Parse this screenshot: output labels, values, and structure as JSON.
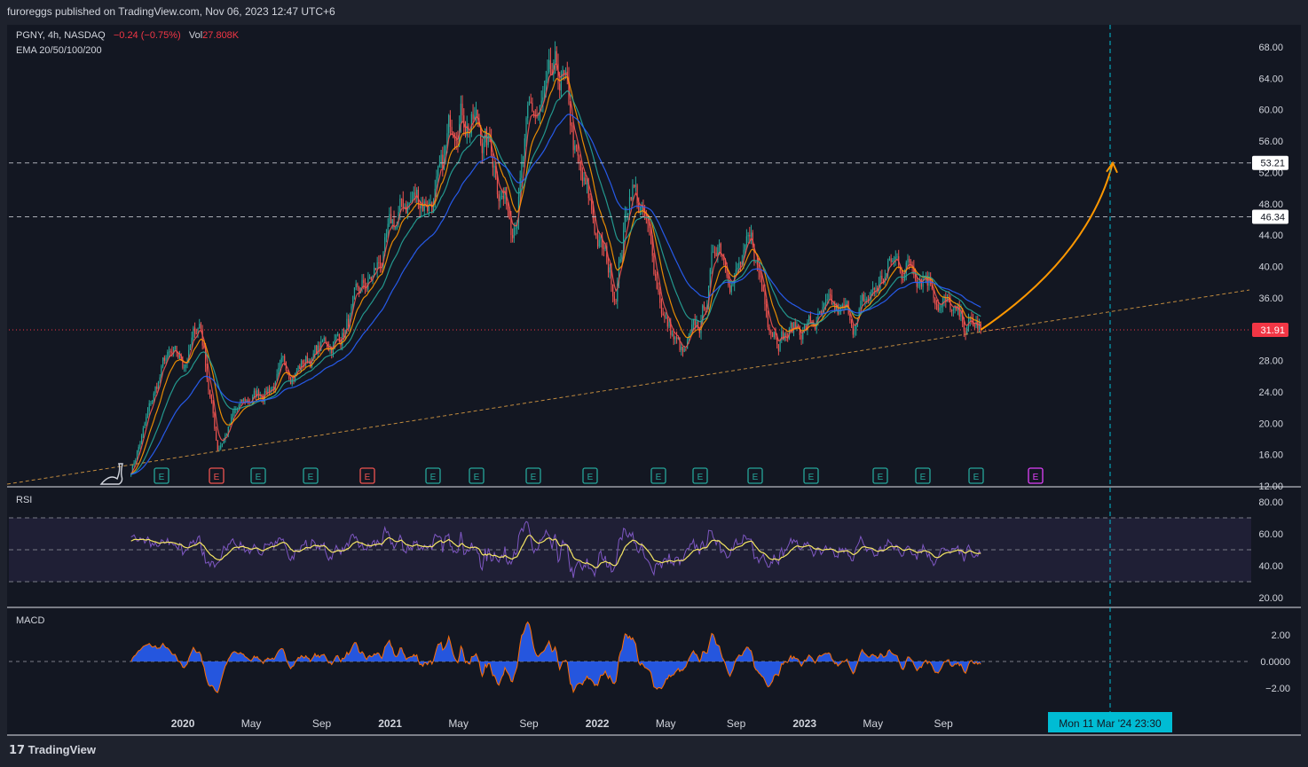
{
  "header": {
    "published": "furoreggs published on TradingView.com, Nov 06, 2023 12:47 UTC+6",
    "symbol_line": "PGNY, 4h, NASDAQ",
    "change": "−0.24 (−0.75%)",
    "vol_label": "Vol",
    "vol_value": "27.808K",
    "indicator": "EMA 20/50/100/200"
  },
  "panes": {
    "rsi_label": "RSI",
    "macd_label": "MACD"
  },
  "brand": {
    "name": "TradingView",
    "logo_icon": "tradingview-logo-icon"
  },
  "colors": {
    "background": "#131722",
    "up": "#26a69a",
    "down": "#ef5350",
    "ema20": "#ef5350",
    "ema50": "#ff9800",
    "ema100": "#26a69a",
    "ema200": "#2962ff",
    "rsi": "#7e57c2",
    "rsi_ma": "#f5e663",
    "macd_fill": "#2962ff",
    "macd_line": "#ff6d00",
    "arrow": "#ff9800",
    "trendline": "#c08a3e",
    "crosshair": "#00bcd4",
    "last_price": "#f23645"
  },
  "chart_data": [
    {
      "type": "candlestick",
      "title": "PGNY, 4h, NASDAQ",
      "x_tick_labels": [
        "2020",
        "May",
        "Sep",
        "2021",
        "May",
        "Sep",
        "2022",
        "May",
        "Sep",
        "2023",
        "May",
        "Sep",
        "Sep"
      ],
      "y_tick_labels": [
        "68.00",
        "64.00",
        "60.00",
        "56.00",
        "52.00",
        "48.00",
        "44.00",
        "40.00",
        "36.00",
        "32.00",
        "28.00",
        "24.00",
        "20.00",
        "16.00",
        "12.00"
      ],
      "ylim": [
        12,
        68
      ],
      "price_labels": [
        "53.21",
        "46.34",
        "31.91"
      ],
      "horizontal_levels": [
        53.21,
        46.34
      ],
      "last_price": 31.91,
      "crosshair_label": "Mon 11 Mar '24   23:30",
      "earnings_markers": [
        "E",
        "E",
        "E",
        "E",
        "E",
        "E",
        "E",
        "E",
        "E",
        "E",
        "E",
        "E",
        "E",
        "E",
        "E",
        "E",
        "E"
      ],
      "approx_closes": [
        {
          "x": "2019-10",
          "y": 14
        },
        {
          "x": "2019-12",
          "y": 28
        },
        {
          "x": "2020-01",
          "y": 27
        },
        {
          "x": "2020-02",
          "y": 33
        },
        {
          "x": "2020-03",
          "y": 17
        },
        {
          "x": "2020-04",
          "y": 21
        },
        {
          "x": "2020-06",
          "y": 25
        },
        {
          "x": "2020-08",
          "y": 28
        },
        {
          "x": "2020-10",
          "y": 31
        },
        {
          "x": "2020-12",
          "y": 38
        },
        {
          "x": "2021-02",
          "y": 48
        },
        {
          "x": "2021-04",
          "y": 50
        },
        {
          "x": "2021-05",
          "y": 63
        },
        {
          "x": "2021-07",
          "y": 54
        },
        {
          "x": "2021-08",
          "y": 47
        },
        {
          "x": "2021-09",
          "y": 57
        },
        {
          "x": "2021-11",
          "y": 62
        },
        {
          "x": "2021-12",
          "y": 50
        },
        {
          "x": "2022-02",
          "y": 37
        },
        {
          "x": "2022-03",
          "y": 52
        },
        {
          "x": "2022-05",
          "y": 33
        },
        {
          "x": "2022-06",
          "y": 28
        },
        {
          "x": "2022-07",
          "y": 32
        },
        {
          "x": "2022-08",
          "y": 44
        },
        {
          "x": "2022-09",
          "y": 40
        },
        {
          "x": "2022-10",
          "y": 41
        },
        {
          "x": "2022-11",
          "y": 34
        },
        {
          "x": "2022-12",
          "y": 32
        },
        {
          "x": "2023-02",
          "y": 33
        },
        {
          "x": "2023-04",
          "y": 33
        },
        {
          "x": "2023-06",
          "y": 40
        },
        {
          "x": "2023-08",
          "y": 41
        },
        {
          "x": "2023-09",
          "y": 36
        },
        {
          "x": "2023-10",
          "y": 32
        },
        {
          "x": "2023-11",
          "y": 31.91
        }
      ]
    },
    {
      "type": "line",
      "title": "RSI",
      "y_tick_labels": [
        "80.00",
        "60.00",
        "40.00",
        "20.00"
      ],
      "ylim": [
        20,
        80
      ],
      "band": [
        30,
        70
      ],
      "midline": 50
    },
    {
      "type": "area",
      "title": "MACD",
      "y_tick_labels": [
        "2.00",
        "0.0000",
        "−2.00"
      ],
      "ylim": [
        -3,
        3
      ]
    }
  ]
}
